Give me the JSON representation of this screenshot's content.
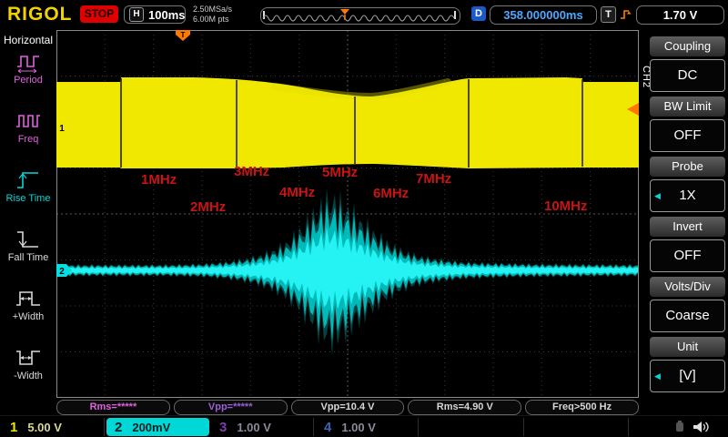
{
  "topbar": {
    "brand": "RIGOL",
    "status": "STOP",
    "h_label": "H",
    "timebase": "100ms",
    "sample_rate": "2.50MSa/s",
    "mem_depth": "6.00M pts",
    "d_label": "D",
    "delay": "358.000000ms",
    "t_label": "T",
    "trigger_level": "1.70 V"
  },
  "sidebar": {
    "title": "Horizontal",
    "items": [
      {
        "label": "Period",
        "color": "#e060e0"
      },
      {
        "label": "Freq",
        "color": "#e060e0"
      },
      {
        "label": "Rise Time",
        "color": "#00d8d8"
      },
      {
        "label": "Fall Time",
        "color": "#d8d8d8"
      },
      {
        "label": "+Width",
        "color": "#d8d8d8"
      },
      {
        "label": "-Width",
        "color": "#d8d8d8"
      }
    ]
  },
  "plot": {
    "freq_labels": [
      "1MHz",
      "2MHz",
      "3MHz",
      "4MHz",
      "5MHz",
      "6MHz",
      "7MHz",
      "10MHz"
    ],
    "label_color": "#c81414",
    "trigger_marker": "T",
    "ch1_marker": "1",
    "ch2_marker": "2",
    "ch1_color": "#f0e800",
    "ch2_color": "#00e0e0",
    "trigger_color": "#ff7800"
  },
  "measurements": [
    {
      "text": "Rms=*****",
      "color": "#e060e0"
    },
    {
      "text": "Vpp=*****",
      "color": "#9a5fd8"
    },
    {
      "text": "Vpp=10.4 V",
      "color": "#d8d8d8"
    },
    {
      "text": "Rms=4.90 V",
      "color": "#d8d8d8"
    },
    {
      "text": "Freq>500 Hz",
      "color": "#d8d8d8"
    }
  ],
  "menu": {
    "tab": "CH2",
    "sections": [
      {
        "label": "Coupling",
        "value": "DC"
      },
      {
        "label": "BW Limit",
        "value": "OFF"
      },
      {
        "label": "Probe",
        "value": "1X"
      },
      {
        "label": "Invert",
        "value": "OFF"
      },
      {
        "label": "Volts/Div",
        "value": "Coarse"
      },
      {
        "label": "Unit",
        "value": "[V]"
      }
    ]
  },
  "channels": [
    {
      "num": "1",
      "scale": "5.00 V",
      "color": "#f0e800",
      "scale_color": "#d8d890"
    },
    {
      "num": "2",
      "scale": "200mV",
      "color": "#00d8d8",
      "scale_color": "#002020"
    },
    {
      "num": "3",
      "scale": "1.00 V",
      "color": "#7a3fa8",
      "scale_color": "#8a8a9a"
    },
    {
      "num": "4",
      "scale": "1.00 V",
      "color": "#3c64b0",
      "scale_color": "#8a8a9a"
    }
  ],
  "icons": {
    "menu_arrow": "◀"
  }
}
